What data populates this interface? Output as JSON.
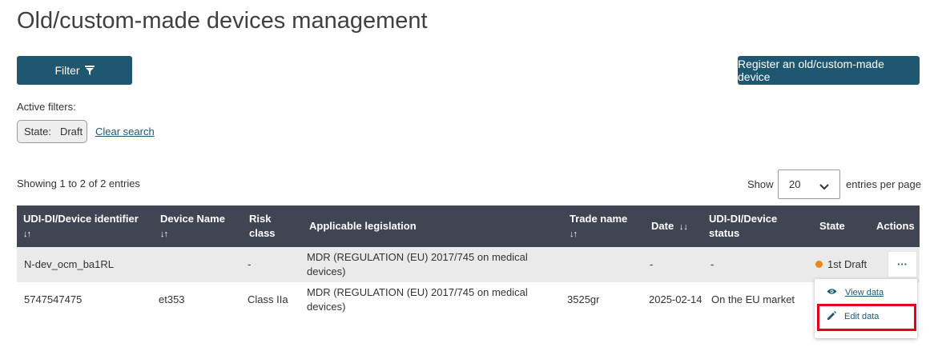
{
  "page": {
    "title": "Old/custom-made devices management"
  },
  "toolbar": {
    "filter_label": "Filter",
    "register_label": "Register an old/custom-made device"
  },
  "filters": {
    "active_label": "Active filters:",
    "chip_key": "State:",
    "chip_value": "Draft",
    "clear_label": "Clear search"
  },
  "pagination": {
    "showing_text": "Showing 1 to 2 of 2 entries",
    "show_label": "Show",
    "page_size": "20",
    "entries_label": "entries per page"
  },
  "table": {
    "headers": {
      "udi": "UDI-DI/Device identifier",
      "device_name": "Device Name",
      "risk_class_1": "Risk",
      "risk_class_2": "class",
      "legislation": "Applicable legislation",
      "trade_name": "Trade name",
      "date": "Date",
      "udi_status_1": "UDI-DI/Device",
      "udi_status_2": "status",
      "state": "State",
      "actions": "Actions"
    },
    "rows": [
      {
        "udi": "N-dev_ocm_ba1RL",
        "device_name": "",
        "risk_class": "-",
        "legislation_1": "MDR (REGULATION (EU) 2017/745 on medical",
        "legislation_2": "devices)",
        "trade_name": "",
        "date": "-",
        "udi_status": "-",
        "state": "1st Draft",
        "actions": "···"
      },
      {
        "udi": "5747547475",
        "device_name": "et353",
        "risk_class": "Class IIa",
        "legislation_1": "MDR (REGULATION (EU) 2017/745 on medical",
        "legislation_2": "devices)",
        "trade_name": "3525gr",
        "date": "2025-02-14",
        "udi_status": "On the EU market"
      }
    ]
  },
  "actions_menu": {
    "view_label": "View data",
    "edit_label": "Edit data"
  },
  "colors": {
    "primary": "#1f5770",
    "header_bg": "#3f4553",
    "state_dot": "#e88a1a",
    "highlight": "#e2001a"
  }
}
